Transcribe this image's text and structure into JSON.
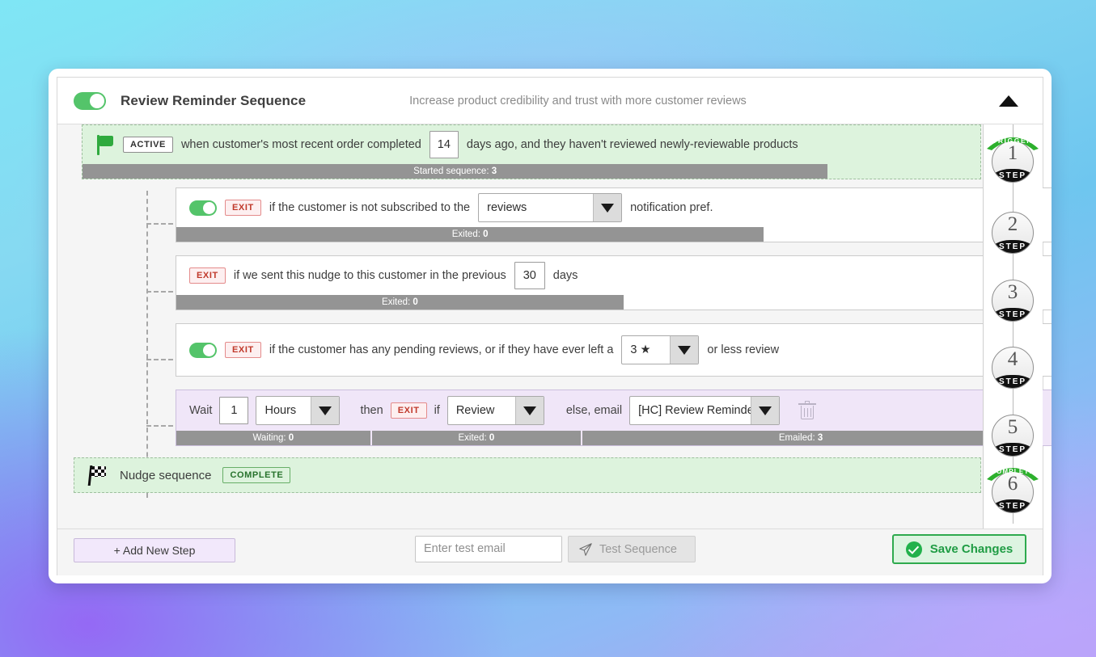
{
  "header": {
    "enabled_toggle": "on",
    "title": "Review Reminder Sequence",
    "description": "Increase product credibility and trust with more customer reviews",
    "collapse_icon": "caret-up-icon"
  },
  "steps": [
    {
      "id": "trigger",
      "kind": "trigger",
      "icon": "green-flag-icon",
      "badge": "ACTIVE",
      "text_before": "when customer's most recent order completed",
      "value": "14",
      "text_after": "days ago, and they haven't reviewed newly-reviewable products",
      "stats": [
        {
          "label": "Started sequence:",
          "value": "3",
          "width_pct": 83
        }
      ]
    },
    {
      "id": "exit-notification-pref",
      "kind": "exit",
      "toggle": "on",
      "badge": "EXIT",
      "text_before": "if the customer is not subscribed to the",
      "select_value": "reviews",
      "text_after": "notification pref.",
      "stats": [
        {
          "label": "Exited:",
          "value": "0",
          "width_pct": 67
        }
      ]
    },
    {
      "id": "exit-previous-nudge",
      "kind": "exit",
      "toggle": null,
      "badge": "EXIT",
      "text_before": "if we sent this nudge to this customer in the previous",
      "value": "30",
      "text_after": "days",
      "stats": [
        {
          "label": "Exited:",
          "value": "0",
          "width_pct": 51
        }
      ]
    },
    {
      "id": "exit-pending-reviews",
      "kind": "exit",
      "toggle": "on",
      "badge": "EXIT",
      "text_before": "if the customer has any pending reviews, or if they have ever left a",
      "select_value": "3 ★",
      "text_after": "or less review",
      "stats": []
    },
    {
      "id": "wait-email",
      "kind": "wait",
      "wait_label": "Wait",
      "wait_value": "1",
      "unit_select": "Hours",
      "then_label": "then",
      "badge": "EXIT",
      "if_label": "if",
      "condition_select": "Review",
      "else_label": "else, email",
      "email_select": "[HC] Review Reminder: We'd love your feedback",
      "delete_icon": "trash-icon",
      "stats": [
        {
          "label": "Waiting:",
          "value": "0",
          "width_pct": 23
        },
        {
          "label": "Exited:",
          "value": "0",
          "width_pct": 25
        },
        {
          "label": "Emailed:",
          "value": "3",
          "width_pct": 48
        }
      ]
    },
    {
      "id": "complete",
      "kind": "complete",
      "icon": "checkered-flag-icon",
      "text": "Nudge sequence",
      "badge": "COMPLETE"
    }
  ],
  "step_badges": [
    {
      "number": "1",
      "base": "STEP",
      "ribbon": "TRIGGER"
    },
    {
      "number": "2",
      "base": "STEP",
      "ribbon": ""
    },
    {
      "number": "3",
      "base": "STEP",
      "ribbon": ""
    },
    {
      "number": "4",
      "base": "STEP",
      "ribbon": ""
    },
    {
      "number": "5",
      "base": "STEP",
      "ribbon": ""
    },
    {
      "number": "6",
      "base": "STEP",
      "ribbon": "COMPLETE"
    }
  ],
  "footer": {
    "add_step_label": "+ Add New Step",
    "test_email_placeholder": "Enter test email",
    "test_email_value": "",
    "test_button_label": "Test Sequence",
    "test_button_icon": "paper-plane-icon",
    "save_button_label": "Save Changes",
    "save_button_icon": "check-circle-icon"
  },
  "colors": {
    "accent_green": "#54c46a",
    "save_green": "#22b14c",
    "exit_red": "#c0392b",
    "wait_lavender": "#f0e6f8",
    "trigger_green_bg": "#ddf3dd",
    "stat_grey": "#949494"
  }
}
